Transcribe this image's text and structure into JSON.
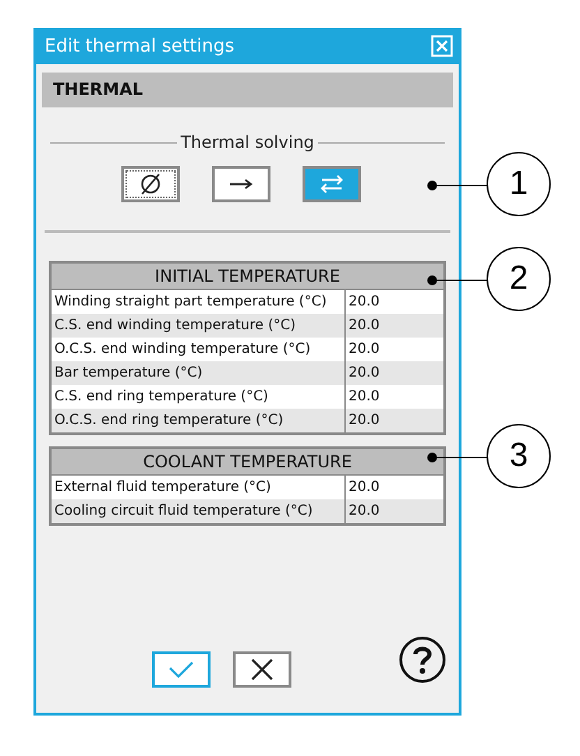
{
  "window": {
    "title": "Edit thermal settings"
  },
  "section": "THERMAL",
  "thermal_solving": {
    "label": "Thermal solving",
    "modes": [
      {
        "kind": "none",
        "selected": false
      },
      {
        "kind": "one-way",
        "selected": false
      },
      {
        "kind": "two-way",
        "selected": true
      }
    ]
  },
  "tables": [
    {
      "title": "INITIAL TEMPERATURE",
      "rows": [
        {
          "label": "Winding straight part temperature (°C)",
          "value": "20.0"
        },
        {
          "label": "C.S. end winding temperature (°C)",
          "value": "20.0"
        },
        {
          "label": "O.C.S. end winding temperature (°C)",
          "value": "20.0"
        },
        {
          "label": "Bar temperature (°C)",
          "value": "20.0"
        },
        {
          "label": "C.S. end ring temperature (°C)",
          "value": "20.0"
        },
        {
          "label": "O.C.S. end ring temperature (°C)",
          "value": "20.0"
        }
      ]
    },
    {
      "title": "COOLANT TEMPERATURE",
      "rows": [
        {
          "label": "External fluid temperature (°C)",
          "value": "20.0"
        },
        {
          "label": "Cooling circuit fluid temperature (°C)",
          "value": "20.0"
        }
      ]
    }
  ],
  "callouts": [
    {
      "number": "1"
    },
    {
      "number": "2"
    },
    {
      "number": "3"
    }
  ]
}
